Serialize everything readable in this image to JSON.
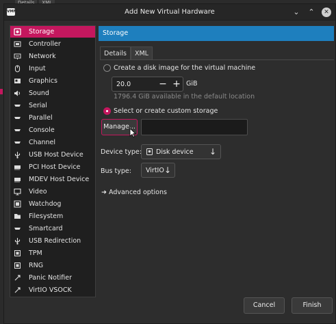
{
  "background": {
    "tabs": [
      "Details",
      "XML"
    ]
  },
  "window": {
    "app_icon_text": "VMM",
    "title": "Add New Virtual Hardware"
  },
  "sidebar": {
    "items": [
      {
        "label": "Storage",
        "icon": "storage-icon",
        "selected": true
      },
      {
        "label": "Controller",
        "icon": "controller-icon"
      },
      {
        "label": "Network",
        "icon": "network-icon"
      },
      {
        "label": "Input",
        "icon": "mouse-icon"
      },
      {
        "label": "Graphics",
        "icon": "graphics-icon"
      },
      {
        "label": "Sound",
        "icon": "sound-icon"
      },
      {
        "label": "Serial",
        "icon": "serial-icon"
      },
      {
        "label": "Parallel",
        "icon": "parallel-icon"
      },
      {
        "label": "Console",
        "icon": "console-icon"
      },
      {
        "label": "Channel",
        "icon": "channel-icon"
      },
      {
        "label": "USB Host Device",
        "icon": "usb-icon"
      },
      {
        "label": "PCI Host Device",
        "icon": "pci-icon"
      },
      {
        "label": "MDEV Host Device",
        "icon": "mdev-icon"
      },
      {
        "label": "Video",
        "icon": "monitor-icon"
      },
      {
        "label": "Watchdog",
        "icon": "watchdog-icon"
      },
      {
        "label": "Filesystem",
        "icon": "filesystem-icon"
      },
      {
        "label": "Smartcard",
        "icon": "smartcard-icon"
      },
      {
        "label": "USB Redirection",
        "icon": "usb-icon"
      },
      {
        "label": "TPM",
        "icon": "tpm-icon"
      },
      {
        "label": "RNG",
        "icon": "rng-icon"
      },
      {
        "label": "Panic Notifier",
        "icon": "panic-icon"
      },
      {
        "label": "VirtIO VSOCK",
        "icon": "vsock-icon"
      }
    ]
  },
  "main": {
    "header": "Storage",
    "tabs": [
      {
        "label": "Details",
        "active": true
      },
      {
        "label": "XML",
        "active": false
      }
    ],
    "create_disk": {
      "label": "Create a disk image for the virtual machine",
      "selected": false,
      "size_value": "20.0",
      "size_unit": "GiB",
      "available": "1796.4 GiB available in the default location"
    },
    "custom_storage": {
      "label": "Select or create custom storage",
      "selected": true,
      "manage_label": "Manage...",
      "path_value": ""
    },
    "device_type": {
      "label": "Device type:",
      "value": "Disk device"
    },
    "bus_type": {
      "label": "Bus type:",
      "value": "VirtIO"
    },
    "advanced_label": "Advanced options"
  },
  "footer": {
    "cancel_label": "Cancel",
    "finish_label": "Finish"
  },
  "colors": {
    "accent": "#c4175e",
    "header_blue": "#1e7fbe",
    "background": "#2d2d2d"
  }
}
